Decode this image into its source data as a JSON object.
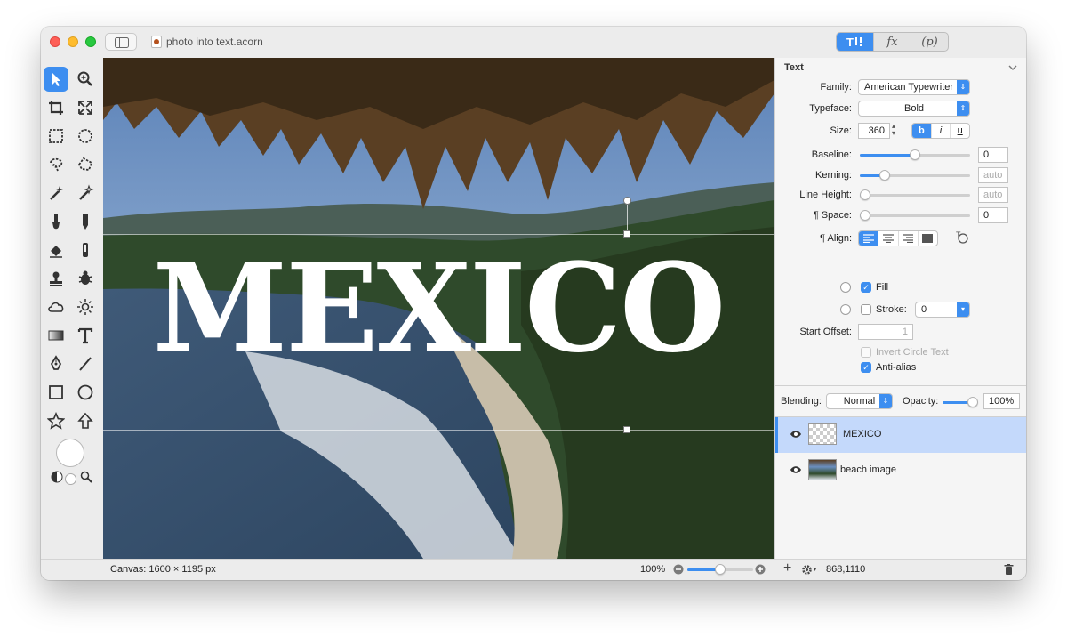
{
  "window": {
    "title": "photo into text.acorn"
  },
  "toolbar_segments": {
    "tools_label": "T",
    "fx_label": "fx",
    "p_label": "(p)"
  },
  "canvas": {
    "text": "MEXICO"
  },
  "text_panel": {
    "heading": "Text",
    "family_label": "Family:",
    "family_value": "American Typewriter",
    "typeface_label": "Typeface:",
    "typeface_value": "Bold",
    "size_label": "Size:",
    "size_value": "360",
    "bold_label": "b",
    "italic_label": "i",
    "underline_label": "u",
    "baseline_label": "Baseline:",
    "baseline_value": "0",
    "kerning_label": "Kerning:",
    "kerning_placeholder": "auto",
    "line_height_label": "Line Height:",
    "line_height_placeholder": "auto",
    "space_label": "¶ Space:",
    "space_value": "0",
    "align_label": "¶ Align:",
    "fill_label": "Fill",
    "stroke_label": "Stroke:",
    "stroke_value": "0",
    "start_offset_label": "Start Offset:",
    "start_offset_value": "1",
    "invert_label": "Invert Circle Text",
    "antialias_label": "Anti-alias",
    "baseline_slider": 0.5,
    "kerning_slider": 0.2,
    "line_height_slider": 0.0,
    "space_slider": 0.0
  },
  "layers_panel": {
    "blending_label": "Blending:",
    "blending_value": "Normal",
    "opacity_label": "Opacity:",
    "opacity_value": "100%",
    "opacity_slider": 1.0,
    "layers": [
      {
        "name": "MEXICO",
        "selected": true
      },
      {
        "name": "beach image",
        "selected": false
      }
    ]
  },
  "status": {
    "canvas_info": "Canvas: 1600 × 1195 px",
    "zoom": "100%",
    "coords": "868,1110"
  },
  "colors": {
    "accent": "#3d8ef0",
    "selected_layer": "#c4d9fb"
  }
}
